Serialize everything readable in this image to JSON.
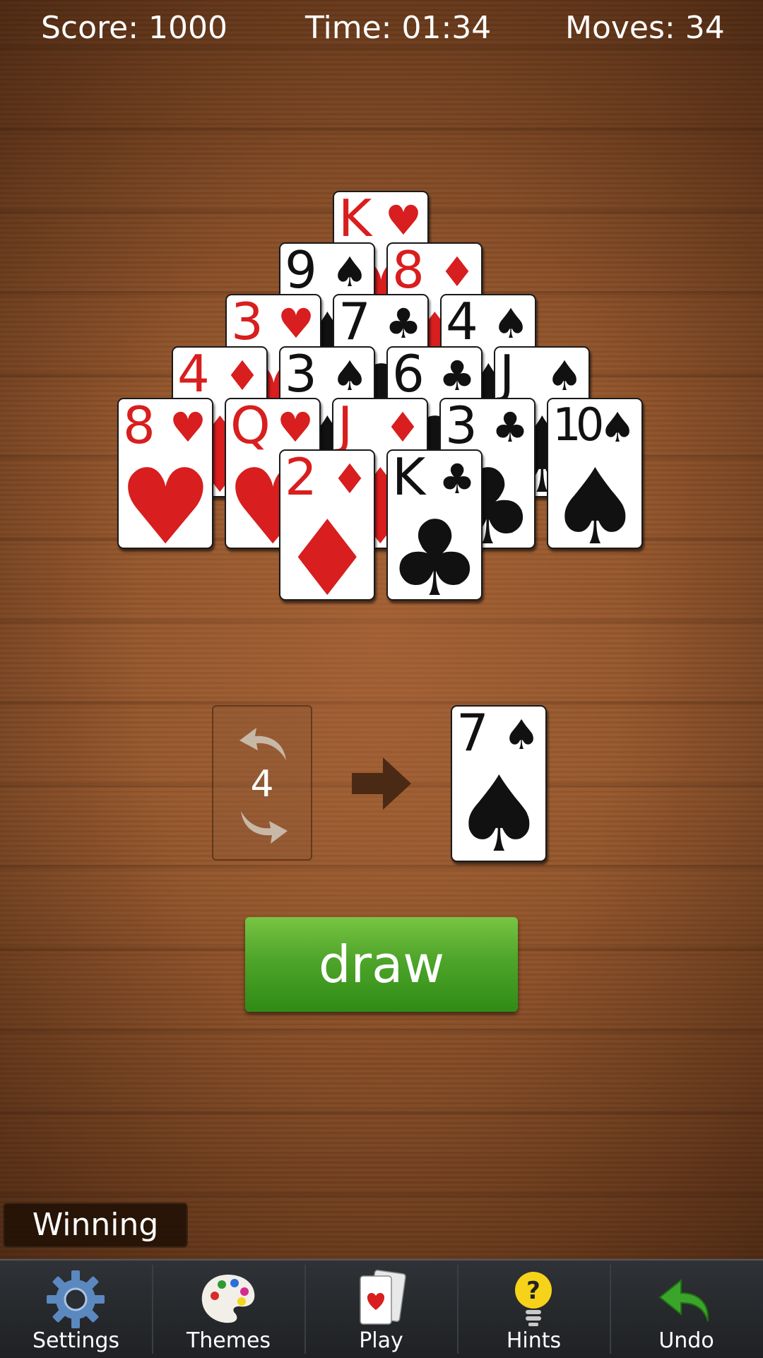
{
  "header": {
    "score": "Score: 1000",
    "time": "Time: 01:34",
    "moves": "Moves: 34"
  },
  "pyramid": [
    {
      "rank": "K",
      "suit": "♥",
      "color": "red",
      "row": 1
    },
    {
      "rank": "9",
      "suit": "♠",
      "color": "black",
      "row": 2
    },
    {
      "rank": "8",
      "suit": "♦",
      "color": "red",
      "row": 2
    },
    {
      "rank": "3",
      "suit": "♥",
      "color": "red",
      "row": 3
    },
    {
      "rank": "7",
      "suit": "♣",
      "color": "black",
      "row": 3
    },
    {
      "rank": "4",
      "suit": "♠",
      "color": "black",
      "row": 3
    },
    {
      "rank": "4",
      "suit": "♦",
      "color": "red",
      "row": 4
    },
    {
      "rank": "3",
      "suit": "♠",
      "color": "black",
      "row": 4
    },
    {
      "rank": "6",
      "suit": "♣",
      "color": "black",
      "row": 4
    },
    {
      "rank": "J",
      "suit": "♠",
      "color": "black",
      "row": 4
    },
    {
      "rank": "8",
      "suit": "♥",
      "color": "red",
      "row": 5
    },
    {
      "rank": "Q",
      "suit": "♥",
      "color": "red",
      "row": 5
    },
    {
      "rank": "J",
      "suit": "♦",
      "color": "red",
      "row": 5
    },
    {
      "rank": "3",
      "suit": "♣",
      "color": "black",
      "row": 5
    },
    {
      "rank": "10",
      "suit": "♠",
      "color": "black",
      "row": 5
    },
    {
      "rank": "2",
      "suit": "♦",
      "color": "red",
      "row": 6
    },
    {
      "rank": "K",
      "suit": "♣",
      "color": "black",
      "row": 6
    }
  ],
  "stock": {
    "recycles_left": "4"
  },
  "waste_card": {
    "rank": "7",
    "suit": "♠",
    "color": "black"
  },
  "draw_button": "draw",
  "status_label": "Winning",
  "nav": [
    {
      "label": "Settings",
      "icon": "gear-icon"
    },
    {
      "label": "Themes",
      "icon": "palette-icon"
    },
    {
      "label": "Play",
      "icon": "cards-icon"
    },
    {
      "label": "Hints",
      "icon": "lightbulb-icon"
    },
    {
      "label": "Undo",
      "icon": "undo-arrow-icon"
    }
  ],
  "colors": {
    "red_suit": "#d81e1e",
    "black_suit": "#111111",
    "draw_button": "#4ea52a",
    "undo_arrow": "#3aa52a"
  }
}
